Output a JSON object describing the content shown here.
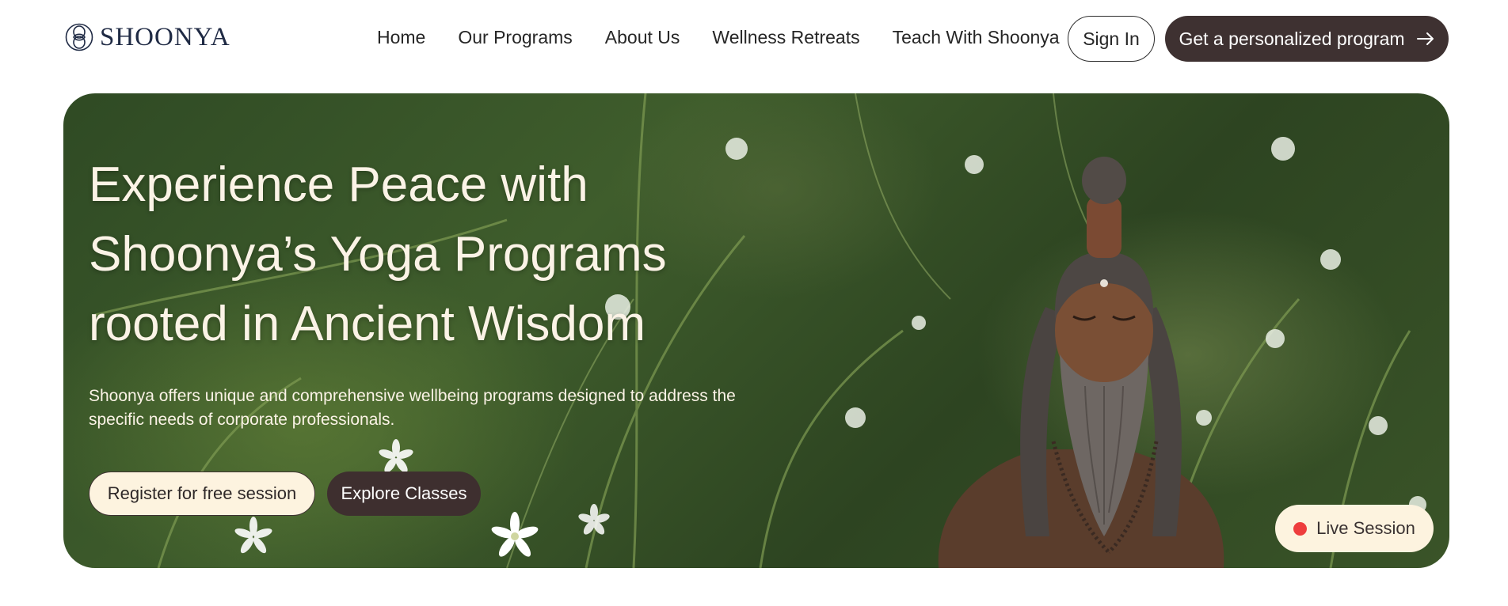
{
  "brand": {
    "name": "SHOONYA",
    "logo_icon": "lotus-knot-icon"
  },
  "nav": {
    "items": [
      {
        "label": "Home"
      },
      {
        "label": "Our Programs"
      },
      {
        "label": "About Us"
      },
      {
        "label": "Wellness Retreats"
      },
      {
        "label": "Teach With Shoonya"
      }
    ]
  },
  "header": {
    "signin_label": "Sign In",
    "cta_label": "Get a personalized program",
    "cta_icon": "arrow-right-icon"
  },
  "hero": {
    "title_line1": "Experience Peace with",
    "title_line2": "Shoonya’s Yoga Programs",
    "title_line3": "rooted in Ancient Wisdom",
    "subtitle_line1": "Shoonya offers unique and comprehensive wellbeing programs designed to address the",
    "subtitle_line2": "specific needs of corporate professionals.",
    "register_label": "Register for free session",
    "explore_label": "Explore Classes",
    "live_label": "Live Session",
    "image": "yogi-statue-in-flower-meadow"
  },
  "colors": {
    "brand_dark": "#3e3131",
    "cream": "#fdf3df",
    "live_red": "#ee3d3d",
    "logo_navy": "#1f2a44"
  }
}
